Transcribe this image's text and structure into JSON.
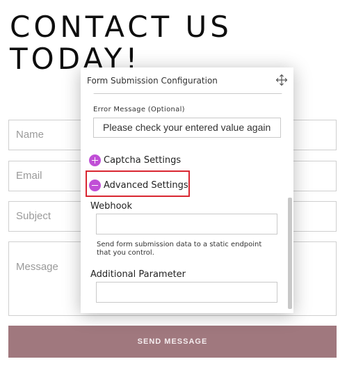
{
  "page": {
    "heading_line1": "CONTACT US",
    "heading_line2": "TODAY!"
  },
  "form": {
    "name_placeholder": "Name",
    "email_placeholder": "Email",
    "subject_placeholder": "Subject",
    "message_placeholder": "Message",
    "send_label": "SEND MESSAGE"
  },
  "panel": {
    "title": "Form Submission Configuration",
    "move_icon": "move-arrows-icon",
    "error_message_label": "Error Message (Optional)",
    "error_message_value": "Please check your entered value again",
    "captcha_label": "Captcha Settings",
    "captcha_icon": "plus-circle-icon",
    "advanced_label": "Advanced Settings",
    "advanced_icon": "minus-circle-icon",
    "webhook_label": "Webhook",
    "webhook_value": "",
    "webhook_help": "Send form submission data to a static endpoint that you control.",
    "additional_param_label": "Additional Parameter",
    "additional_param_value": ""
  },
  "colors": {
    "accent_purple": "#c04fd6",
    "highlight_red": "#d92631",
    "send_button": "#a0787e"
  }
}
